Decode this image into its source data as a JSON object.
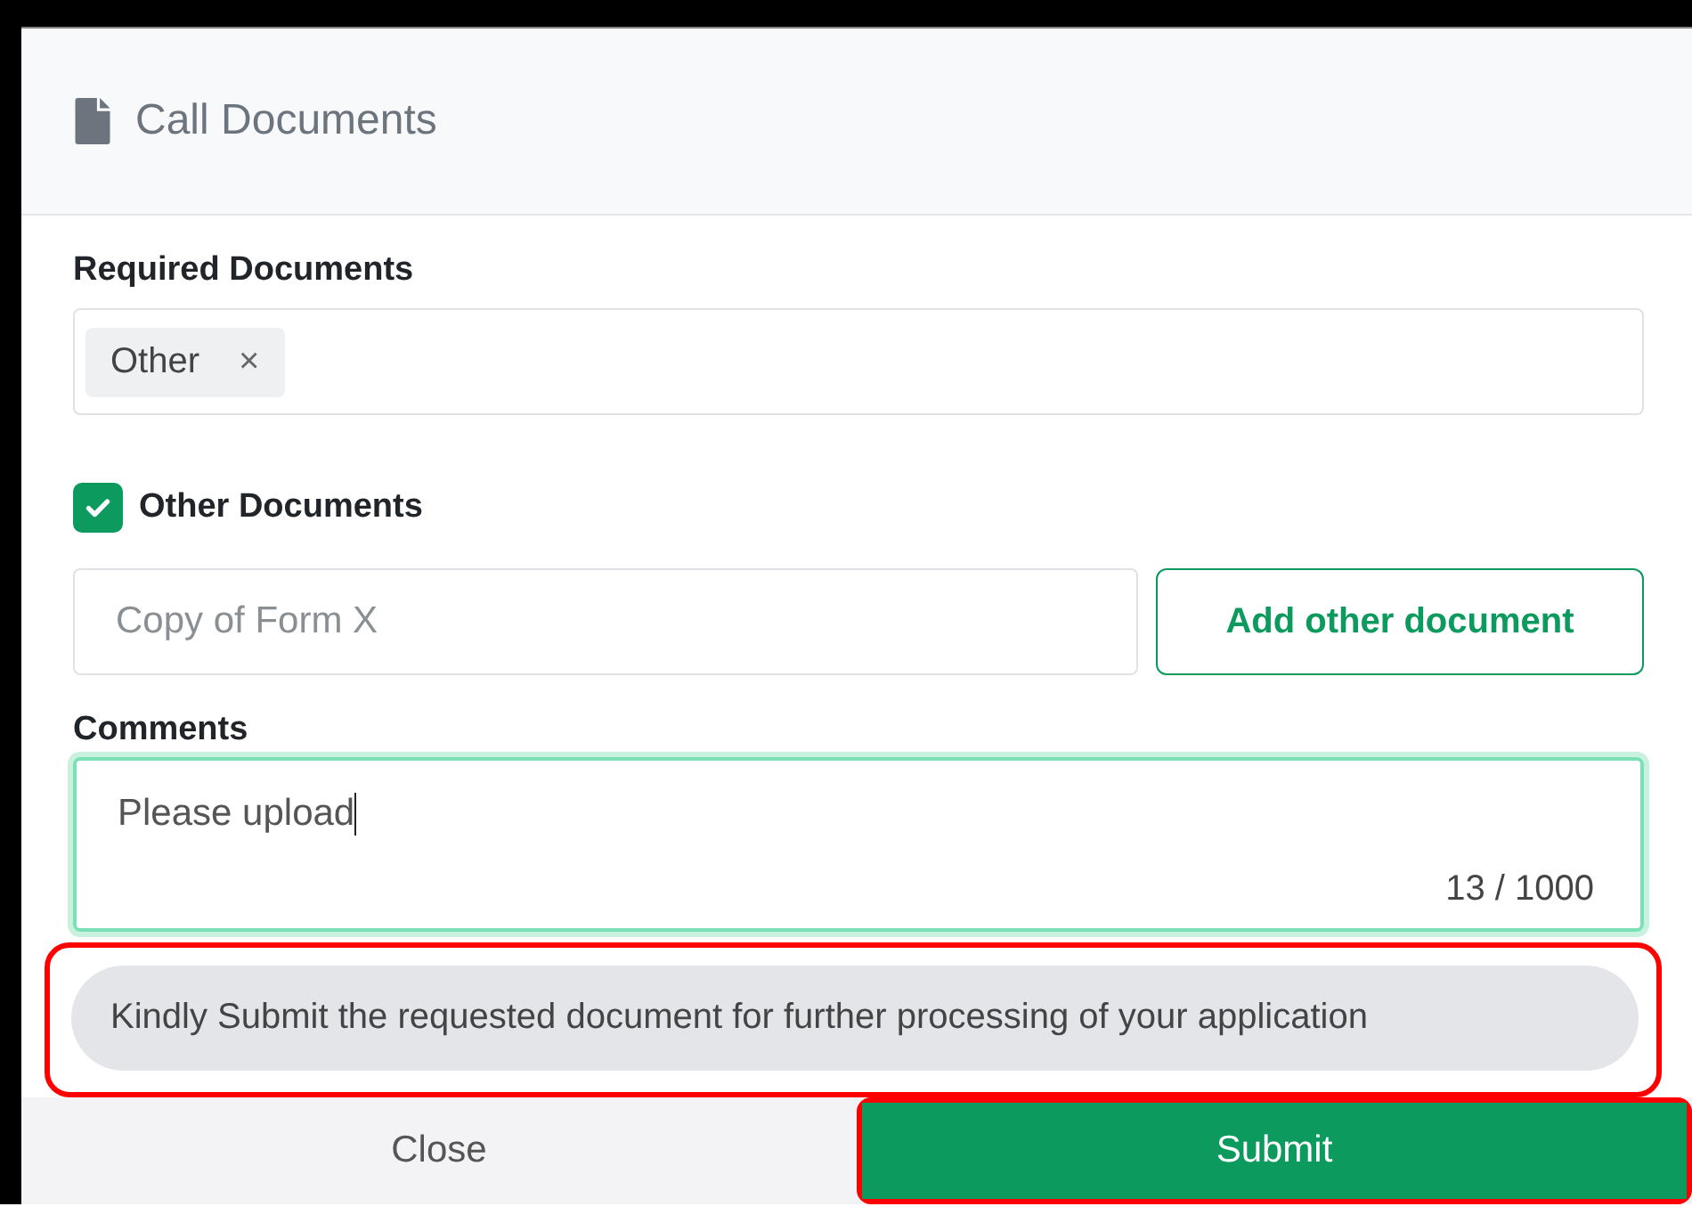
{
  "dialog": {
    "title": "Call Documents"
  },
  "required_documents": {
    "label": "Required Documents",
    "tags": [
      {
        "label": "Other",
        "remove": "×"
      }
    ]
  },
  "other_documents": {
    "label": "Other Documents",
    "checked": true,
    "placeholder": "Copy of Form X",
    "button": "Add other document"
  },
  "comments": {
    "label": "Comments",
    "value": "Please upload",
    "counter": "13 / 1000",
    "focused": true
  },
  "notice": {
    "text": "Kindly Submit the requested document for further processing of your application",
    "highlighted": true
  },
  "footer": {
    "buttons": [
      {
        "kind": "secondary",
        "label": "Close",
        "highlighted": false
      },
      {
        "kind": "primary",
        "label": "Submit",
        "highlighted": true
      }
    ]
  }
}
